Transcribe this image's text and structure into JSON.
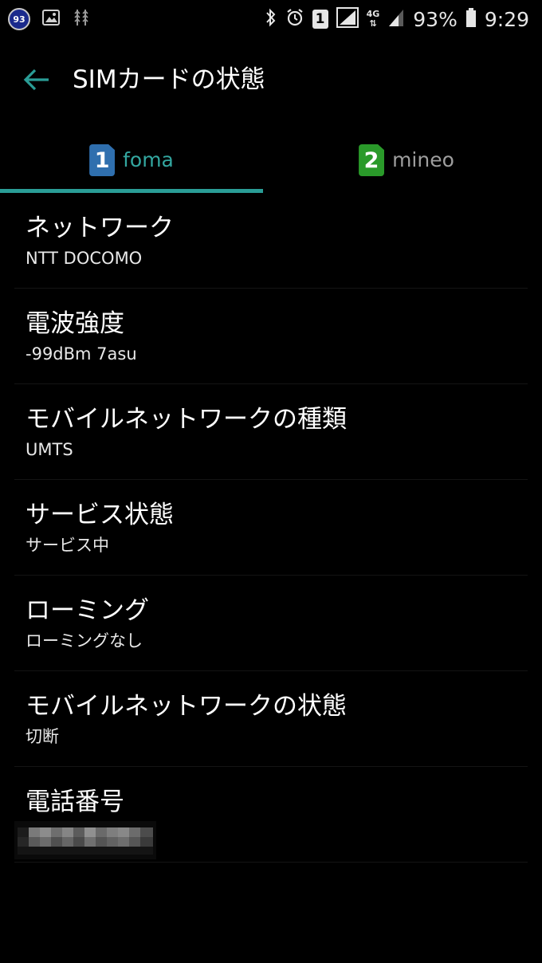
{
  "status_bar": {
    "notification_badge": "93",
    "sim_slot": "1",
    "network_type": "4G",
    "battery_percent": "93%",
    "time": "9:29",
    "icons": [
      "gallery-icon",
      "usb-icon",
      "bluetooth-icon",
      "alarm-icon",
      "signal-icon",
      "battery-icon"
    ]
  },
  "app_bar": {
    "title": "SIMカードの状態"
  },
  "tabs": [
    {
      "number": "1",
      "label": "foma",
      "color": "#2f6fae",
      "selected": true
    },
    {
      "number": "2",
      "label": "mineo",
      "color": "#2a9a2a",
      "selected": false
    }
  ],
  "items": [
    {
      "title": "ネットワーク",
      "value": "NTT DOCOMO"
    },
    {
      "title": "電波強度",
      "value": "-99dBm 7asu"
    },
    {
      "title": "モバイルネットワークの種類",
      "value": "UMTS"
    },
    {
      "title": "サービス状態",
      "value": "サービス中"
    },
    {
      "title": "ローミング",
      "value": "ローミングなし"
    },
    {
      "title": "モバイルネットワークの状態",
      "value": "切断"
    },
    {
      "title": "電話番号",
      "value": ""
    }
  ],
  "colors": {
    "accent": "#2a9d96",
    "background": "#000000"
  }
}
